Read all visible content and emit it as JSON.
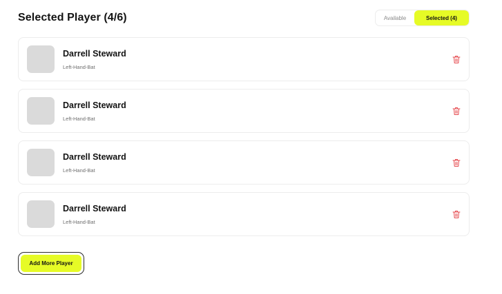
{
  "header": {
    "title": "Selected Player (4/6)",
    "tabs": {
      "available": "Available",
      "selected": "Selected (4)"
    }
  },
  "players": [
    {
      "name": "Darrell Steward",
      "role": "Left-Hand-Bat"
    },
    {
      "name": "Darrell Steward",
      "role": "Left-Hand-Bat"
    },
    {
      "name": "Darrell Steward",
      "role": "Left-Hand-Bat"
    },
    {
      "name": "Darrell Steward",
      "role": "Left-Hand-Bat"
    }
  ],
  "actions": {
    "add_more": "Add More Player"
  },
  "icons": {
    "delete": "trash-icon"
  },
  "colors": {
    "accent": "#e6fb26",
    "delete": "#e5484d",
    "avatar_placeholder": "#dadada"
  }
}
